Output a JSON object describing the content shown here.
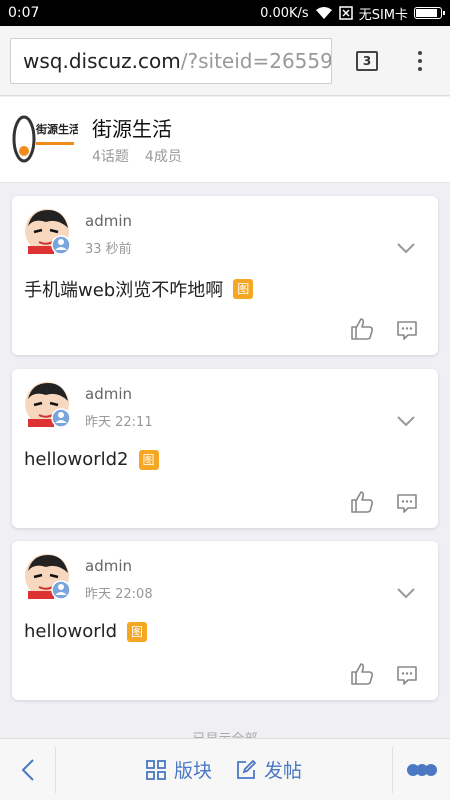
{
  "statusbar": {
    "time": "0:07",
    "net_speed": "0.00K/s",
    "sim": "无SIM卡",
    "battery_level": 0.9
  },
  "browser": {
    "url_host": "wsq.discuz.com",
    "url_path": "/?siteid=26559",
    "tab_count": "3"
  },
  "community": {
    "name": "街源生活",
    "topics": "4话题",
    "members": "4成员",
    "logo_text": "街源生活"
  },
  "posts": [
    {
      "author": "admin",
      "time": "33 秒前",
      "text": "手机端web浏览不咋地啊",
      "badge": "图"
    },
    {
      "author": "admin",
      "time": "昨天 22:11",
      "text": "helloworld2",
      "badge": "图"
    },
    {
      "author": "admin",
      "time": "昨天 22:08",
      "text": "helloworld",
      "badge": "图"
    }
  ],
  "more_hint": "已显示全部",
  "bottombar": {
    "boards_label": "版块",
    "post_label": "发帖"
  },
  "colors": {
    "accent": "#4a78c3",
    "badge": "#f5a623",
    "background": "#efeff4"
  }
}
